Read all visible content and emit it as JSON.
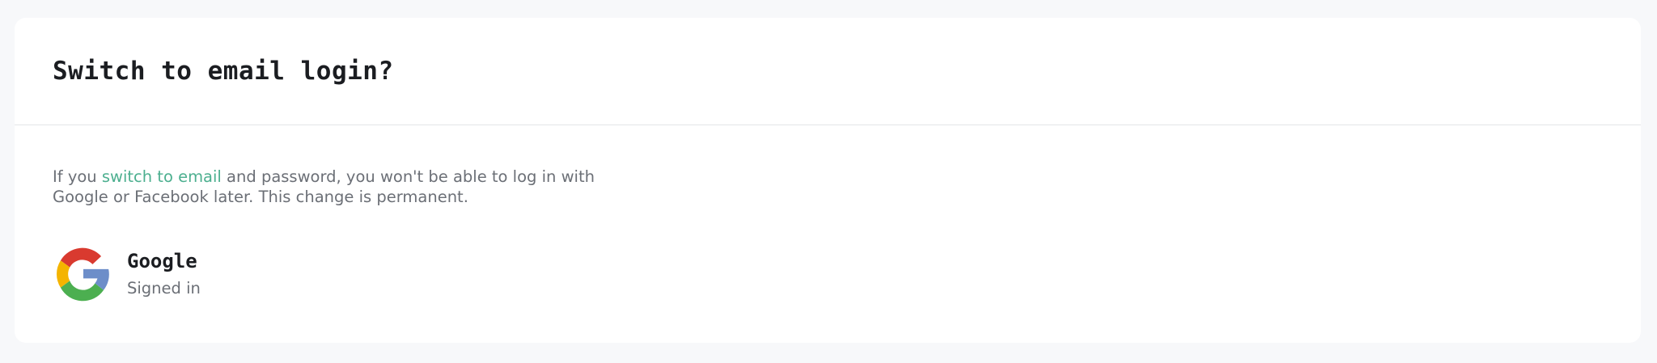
{
  "dialog": {
    "title": "Switch to email login?",
    "description": {
      "before_link": "If you ",
      "link_text": "switch to email",
      "after_link": " and password, you won't be able to log in with Google or Facebook later. This change is permanent."
    },
    "provider": {
      "icon": "google-logo-icon",
      "name": "Google",
      "status": "Signed in"
    }
  },
  "colors": {
    "page_background": "#f7f8fa",
    "card_background": "#ffffff",
    "title_text": "#1b1d21",
    "body_text": "#6b6f76",
    "link": "#4caf8f",
    "divider": "#e3e5e8",
    "google_red": "#d93a2f",
    "google_yellow": "#f4b400",
    "google_green": "#4caf50",
    "google_blue": "#6d8ec9"
  }
}
